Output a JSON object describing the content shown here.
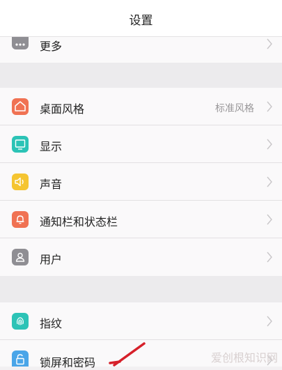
{
  "header": {
    "title": "设置"
  },
  "sections": [
    {
      "items": [
        {
          "label": "更多",
          "icon": "more-dots-icon",
          "color": "#8f8e93"
        }
      ]
    },
    {
      "items": [
        {
          "label": "桌面风格",
          "value": "标准风格",
          "icon": "home-icon",
          "color": "#f07253"
        },
        {
          "label": "显示",
          "icon": "display-icon",
          "color": "#2cc3b6"
        },
        {
          "label": "声音",
          "icon": "speaker-icon",
          "color": "#f5c531"
        },
        {
          "label": "通知栏和状态栏",
          "icon": "bell-icon",
          "color": "#f07253"
        },
        {
          "label": "用户",
          "icon": "user-icon",
          "color": "#8f8e93"
        }
      ]
    },
    {
      "items": [
        {
          "label": "指纹",
          "icon": "fingerprint-icon",
          "color": "#2cc3b6"
        },
        {
          "label": "锁屏和密码",
          "icon": "lock-icon",
          "color": "#4aa5e8"
        }
      ]
    }
  ],
  "watermark": "爱创根知识网",
  "colors": {
    "background": "#f2f0f2",
    "row": "#faf9fa",
    "annotation_arrow": "#d6202a"
  }
}
